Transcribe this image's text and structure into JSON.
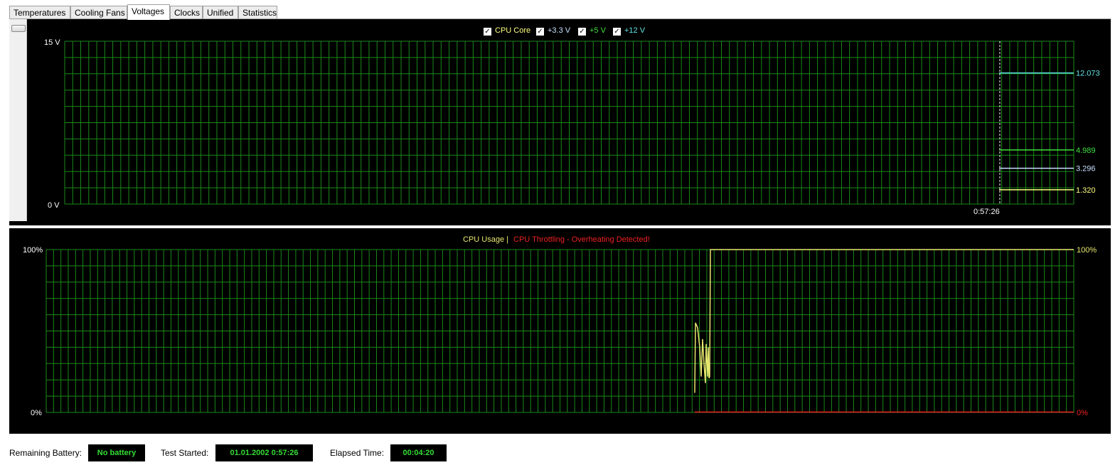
{
  "tabs": [
    {
      "label": "Temperatures",
      "active": false
    },
    {
      "label": "Cooling Fans",
      "active": false
    },
    {
      "label": "Voltages",
      "active": true
    },
    {
      "label": "Clocks",
      "active": false
    },
    {
      "label": "Unified",
      "active": false
    },
    {
      "label": "Statistics",
      "active": false
    }
  ],
  "voltage_chart": {
    "legend": [
      {
        "label": "CPU Core",
        "checked": true,
        "color": "#ffff80"
      },
      {
        "label": "+3.3 V",
        "checked": true,
        "color": "#c8e0ff"
      },
      {
        "label": "+5 V",
        "checked": true,
        "color": "#40e040"
      },
      {
        "label": "+12 V",
        "checked": true,
        "color": "#60e0e0"
      }
    ],
    "y_max_label": "15 V",
    "y_min_label": "0 V",
    "time_label": "0:57:26",
    "grid_color": "#1a8a1a"
  },
  "usage_chart": {
    "title_usage": "CPU Usage",
    "separator": "|",
    "title_throttle": "CPU Throttling - Overheating Detected!",
    "usage_color": "#e8e870",
    "throttle_color": "#ee2222",
    "y_max_label": "100%",
    "y_min_label": "0%",
    "right_max_label": "100%",
    "right_min_label": "0%"
  },
  "chart_data": [
    {
      "type": "line",
      "title": "",
      "ylim": [
        0,
        15
      ],
      "y_unit": "V",
      "x_label_at_marker": "0:57:26",
      "series": [
        {
          "name": "CPU Core",
          "color": "#ffff80",
          "current": "1.320",
          "value": 1.32
        },
        {
          "name": "+3.3 V",
          "color": "#c8e0ff",
          "current": "3.296",
          "value": 3.296
        },
        {
          "name": "+5 V",
          "color": "#40e040",
          "current": "4.989",
          "value": 4.989
        },
        {
          "name": "+12 V",
          "color": "#60e0e0",
          "current": "12.073",
          "value": 12.073
        }
      ]
    },
    {
      "type": "line",
      "title": "",
      "ylim": [
        0,
        100
      ],
      "y_unit": "%",
      "series": [
        {
          "name": "CPU Usage",
          "color": "#e8e870",
          "points": [
            [
              0,
              12
            ],
            [
              1,
              55
            ],
            [
              2,
              52
            ],
            [
              3,
              40
            ],
            [
              4,
              22
            ],
            [
              5,
              45
            ],
            [
              6,
              30
            ],
            [
              7,
              18
            ],
            [
              8,
              42
            ],
            [
              9,
              22
            ],
            [
              10,
              40
            ],
            [
              11,
              21
            ],
            [
              12,
              22
            ],
            [
              13,
              100
            ],
            [
              14,
              100
            ],
            [
              15,
              100
            ]
          ]
        },
        {
          "name": "CPU Throttling - Overheating Detected!",
          "color": "#ee2222",
          "points": [
            [
              0,
              0
            ],
            [
              15,
              0
            ]
          ]
        }
      ]
    }
  ],
  "status": {
    "battery_label": "Remaining Battery:",
    "battery_value": "No battery",
    "test_started_label": "Test Started:",
    "test_started_value": "01.01.2002 0:57:26",
    "elapsed_label": "Elapsed Time:",
    "elapsed_value": "00:04:20"
  }
}
